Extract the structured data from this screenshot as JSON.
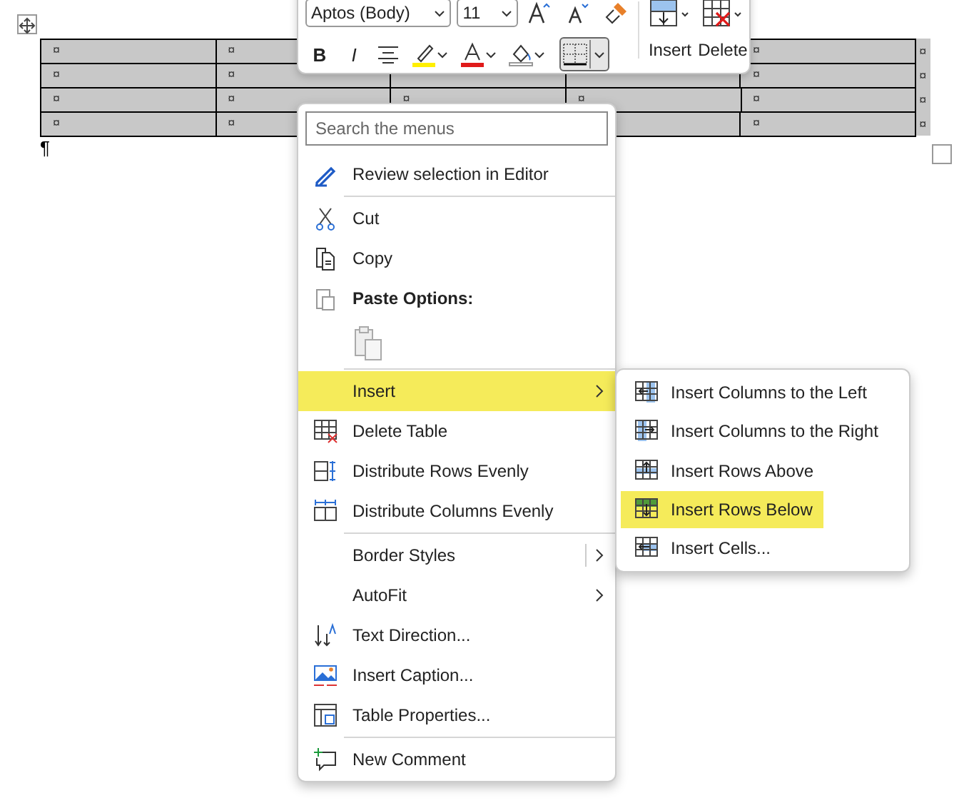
{
  "table": {
    "rows": [
      [
        "¤",
        "¤",
        null,
        null,
        "¤"
      ],
      [
        "¤",
        "¤",
        null,
        null,
        "¤"
      ],
      [
        "¤",
        "¤",
        "¤",
        "¤",
        "¤"
      ],
      [
        "¤",
        "¤",
        null,
        null,
        "¤"
      ]
    ],
    "row_end_marks": [
      "¤",
      "¤",
      "¤",
      "¤"
    ]
  },
  "paragraph_mark": "¶",
  "mini_toolbar": {
    "font": "Aptos (Body)",
    "size": "11",
    "insert_label": "Insert",
    "delete_label": "Delete",
    "bold": "B",
    "italic": "I",
    "borders_selected": true
  },
  "context_menu": {
    "search": {
      "placeholder": "Search the menus"
    },
    "items": [
      {
        "kind": "item",
        "label": "Review selection in Editor",
        "selected": false,
        "submenu": false
      },
      {
        "kind": "separator"
      },
      {
        "kind": "item",
        "label": "Cut",
        "selected": false,
        "submenu": false
      },
      {
        "kind": "item",
        "label": "Copy",
        "selected": false,
        "submenu": false
      },
      {
        "kind": "heading",
        "label": "Paste Options:"
      },
      {
        "kind": "paste"
      },
      {
        "kind": "separator"
      },
      {
        "kind": "item",
        "label": "Insert",
        "selected": true,
        "submenu": true
      },
      {
        "kind": "item",
        "label": "Delete Table",
        "selected": false,
        "submenu": false
      },
      {
        "kind": "item",
        "label": "Distribute Rows Evenly",
        "selected": false,
        "submenu": false
      },
      {
        "kind": "item",
        "label": "Distribute Columns Evenly",
        "selected": false,
        "submenu": false
      },
      {
        "kind": "separator"
      },
      {
        "kind": "item",
        "label": "Border Styles",
        "selected": false,
        "submenu": true,
        "split": true
      },
      {
        "kind": "item",
        "label": "AutoFit",
        "selected": false,
        "submenu": true
      },
      {
        "kind": "item",
        "label": "Text Direction...",
        "selected": false,
        "submenu": false
      },
      {
        "kind": "item",
        "label": "Insert Caption...",
        "selected": false,
        "submenu": false
      },
      {
        "kind": "item",
        "label": "Table Properties...",
        "selected": false,
        "submenu": false
      },
      {
        "kind": "separator"
      },
      {
        "kind": "item",
        "label": "New Comment",
        "selected": false,
        "submenu": false
      }
    ]
  },
  "insert_submenu": {
    "items": [
      {
        "label": "Insert Columns to the Left",
        "selected": false
      },
      {
        "label": "Insert Columns to the Right",
        "selected": false
      },
      {
        "label": "Insert Rows Above",
        "selected": false
      },
      {
        "label": "Insert Rows Below",
        "selected": true
      },
      {
        "label": "Insert Cells...",
        "selected": false
      }
    ]
  }
}
